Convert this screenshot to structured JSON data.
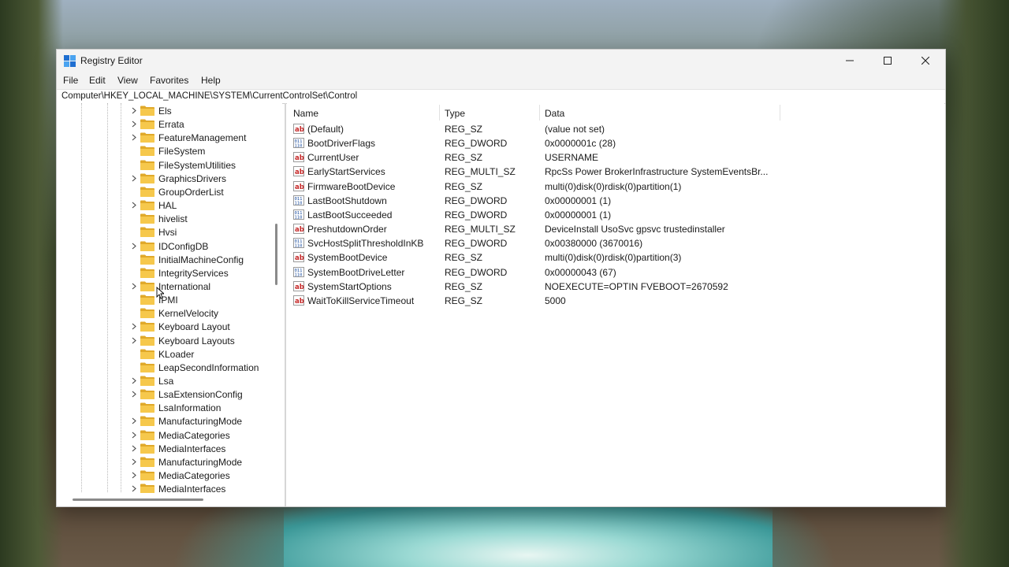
{
  "window": {
    "title": "Registry Editor",
    "icon": "registry-editor-icon",
    "controls": [
      "minimize-icon",
      "maximize-icon",
      "close-icon"
    ]
  },
  "menu": [
    "File",
    "Edit",
    "View",
    "Favorites",
    "Help"
  ],
  "address": "Computer\\HKEY_LOCAL_MACHINE\\SYSTEM\\CurrentControlSet\\Control",
  "tree": {
    "items": [
      {
        "label": "Els",
        "expandable": true
      },
      {
        "label": "Errata",
        "expandable": true
      },
      {
        "label": "FeatureManagement",
        "expandable": true
      },
      {
        "label": "FileSystem",
        "expandable": false
      },
      {
        "label": "FileSystemUtilities",
        "expandable": false
      },
      {
        "label": "GraphicsDrivers",
        "expandable": true
      },
      {
        "label": "GroupOrderList",
        "expandable": false
      },
      {
        "label": "HAL",
        "expandable": true
      },
      {
        "label": "hivelist",
        "expandable": false
      },
      {
        "label": "Hvsi",
        "expandable": false
      },
      {
        "label": "IDConfigDB",
        "expandable": true
      },
      {
        "label": "InitialMachineConfig",
        "expandable": false
      },
      {
        "label": "IntegrityServices",
        "expandable": false
      },
      {
        "label": "International",
        "expandable": true
      },
      {
        "label": "IPMI",
        "expandable": false
      },
      {
        "label": "KernelVelocity",
        "expandable": false
      },
      {
        "label": "Keyboard Layout",
        "expandable": true
      },
      {
        "label": "Keyboard Layouts",
        "expandable": true
      },
      {
        "label": "KLoader",
        "expandable": false
      },
      {
        "label": "LeapSecondInformation",
        "expandable": false
      },
      {
        "label": "Lsa",
        "expandable": true
      },
      {
        "label": "LsaExtensionConfig",
        "expandable": true
      },
      {
        "label": "LsaInformation",
        "expandable": false
      },
      {
        "label": "ManufacturingMode",
        "expandable": true
      },
      {
        "label": "MediaCategories",
        "expandable": true
      },
      {
        "label": "MediaInterfaces",
        "expandable": true
      },
      {
        "label": "ManufacturingMode",
        "expandable": true
      },
      {
        "label": "MediaCategories",
        "expandable": true
      },
      {
        "label": "MediaInterfaces",
        "expandable": true
      }
    ]
  },
  "values": {
    "columns": [
      "Name",
      "Type",
      "Data"
    ],
    "rows": [
      {
        "icon": "string-value-icon",
        "name": "(Default)",
        "type": "REG_SZ",
        "data": "(value not set)"
      },
      {
        "icon": "binary-value-icon",
        "name": "BootDriverFlags",
        "type": "REG_DWORD",
        "data": "0x0000001c (28)"
      },
      {
        "icon": "string-value-icon",
        "name": "CurrentUser",
        "type": "REG_SZ",
        "data": "USERNAME"
      },
      {
        "icon": "string-value-icon",
        "name": "EarlyStartServices",
        "type": "REG_MULTI_SZ",
        "data": "RpcSs Power BrokerInfrastructure SystemEventsBr..."
      },
      {
        "icon": "string-value-icon",
        "name": "FirmwareBootDevice",
        "type": "REG_SZ",
        "data": "multi(0)disk(0)rdisk(0)partition(1)"
      },
      {
        "icon": "binary-value-icon",
        "name": "LastBootShutdown",
        "type": "REG_DWORD",
        "data": "0x00000001 (1)"
      },
      {
        "icon": "binary-value-icon",
        "name": "LastBootSucceeded",
        "type": "REG_DWORD",
        "data": "0x00000001 (1)"
      },
      {
        "icon": "string-value-icon",
        "name": "PreshutdownOrder",
        "type": "REG_MULTI_SZ",
        "data": "DeviceInstall UsoSvc gpsvc trustedinstaller"
      },
      {
        "icon": "binary-value-icon",
        "name": "SvcHostSplitThresholdInKB",
        "type": "REG_DWORD",
        "data": "0x00380000 (3670016)"
      },
      {
        "icon": "string-value-icon",
        "name": "SystemBootDevice",
        "type": "REG_SZ",
        "data": "multi(0)disk(0)rdisk(0)partition(3)"
      },
      {
        "icon": "binary-value-icon",
        "name": "SystemBootDriveLetter",
        "type": "REG_DWORD",
        "data": "0x00000043 (67)"
      },
      {
        "icon": "string-value-icon",
        "name": "SystemStartOptions",
        "type": "REG_SZ",
        "data": " NOEXECUTE=OPTIN  FVEBOOT=2670592"
      },
      {
        "icon": "string-value-icon",
        "name": "WaitToKillServiceTimeout",
        "type": "REG_SZ",
        "data": "5000"
      }
    ]
  },
  "colors": {
    "folder": "#f6c84c",
    "folder_dark": "#e0a92a",
    "string_icon": "#c62828",
    "binary_icon": "#1d4fa0"
  }
}
